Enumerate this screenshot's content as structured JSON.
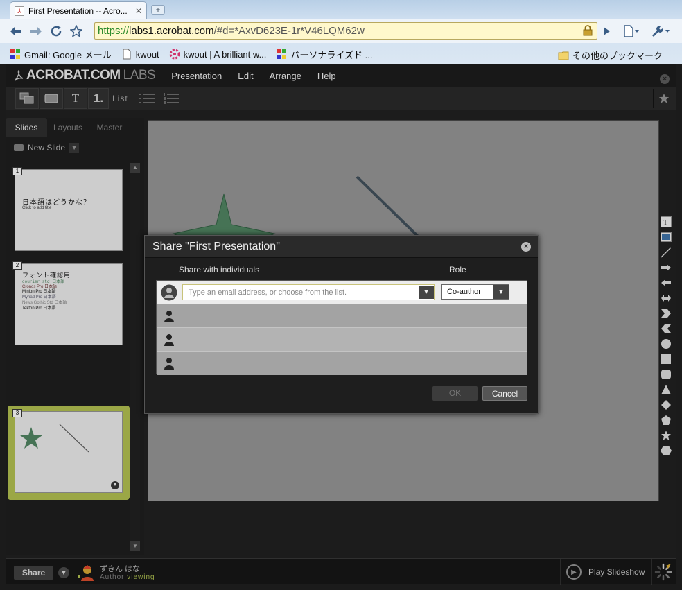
{
  "browser": {
    "tab_title": "First Presentation -- Acro...",
    "tab_close": "✕",
    "new_tab": "+",
    "url_secure": "https://",
    "url_host": "labs1.acrobat.com",
    "url_rest": "/#d=*AxvD623E-1r*V46LQM62w",
    "bookmarks": [
      {
        "label": "Gmail: Google メール",
        "icon": "gmail-icon"
      },
      {
        "label": "kwout",
        "icon": "page-icon"
      },
      {
        "label": "kwout | A brilliant w...",
        "icon": "kwout-flower-icon"
      },
      {
        "label": "パーソナライズド ...",
        "icon": "google-icon"
      }
    ],
    "other_bookmarks": "その他のブックマーク"
  },
  "app": {
    "brand": "ACROBAT.COM",
    "brand_suffix": "LABS",
    "menu": [
      "Presentation",
      "Edit",
      "Arrange",
      "Help"
    ],
    "toolbar": {
      "number_label": "1.",
      "list_label": "List"
    }
  },
  "panel": {
    "tabs": [
      "Slides",
      "Layouts",
      "Master"
    ],
    "active_tab": "Slides",
    "new_slide": "New Slide"
  },
  "slides": [
    {
      "number": "1",
      "title": "日本語はどうかな？",
      "subtitle": "Click to add title"
    },
    {
      "number": "2",
      "title": "フォント確認用",
      "bullets": [
        "courier std  日本語",
        "Cronos Pro  日本語",
        "Minion Pro  日本語",
        "Myriad Pro  日本語",
        "News Gothic Std  日本語",
        "Tekton Pro  日本語"
      ]
    },
    {
      "number": "3",
      "selected": true
    }
  ],
  "bottom": {
    "share": "Share",
    "author_name": "ずきん はな",
    "author_role": "Author",
    "author_status": "viewing",
    "play_slideshow": "Play Slideshow"
  },
  "dialog": {
    "title": "Share \"First Presentation\"",
    "col_individuals": "Share with individuals",
    "col_role": "Role",
    "email_placeholder": "Type an email address, or choose from the list.",
    "email_value": "",
    "role_value": "Co-author",
    "ok": "OK",
    "cancel": "Cancel"
  },
  "colors": {
    "accent_green": "#a4b04a",
    "url_green": "#2b8a2b",
    "star_green": "#4a7a5a"
  }
}
